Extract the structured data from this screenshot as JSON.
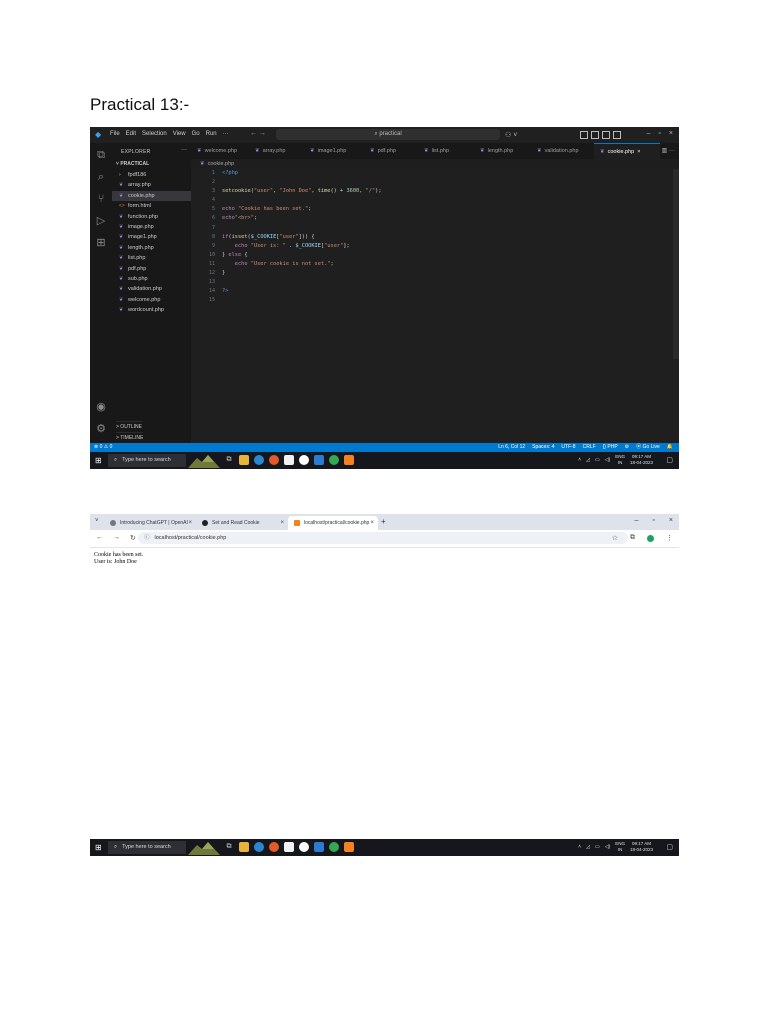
{
  "document": {
    "title": "Practical 13:-"
  },
  "vscode": {
    "menu": [
      "File",
      "Edit",
      "Selection",
      "View",
      "Go",
      "Run",
      "···"
    ],
    "nav_arrows": "← →",
    "search_text": "⌕ practical",
    "explorer_header": "EXPLORER",
    "explorer_dots": "···",
    "project": "PRACTICAL",
    "files": [
      {
        "name": "fpdf186",
        "kind": "folder"
      },
      {
        "name": "array.php",
        "kind": "php"
      },
      {
        "name": "cookie.php",
        "kind": "php"
      },
      {
        "name": "form.html",
        "kind": "html"
      },
      {
        "name": "function.php",
        "kind": "php"
      },
      {
        "name": "image.php",
        "kind": "php"
      },
      {
        "name": "image1.php",
        "kind": "php"
      },
      {
        "name": "length.php",
        "kind": "php"
      },
      {
        "name": "list.php",
        "kind": "php"
      },
      {
        "name": "pdf.php",
        "kind": "php"
      },
      {
        "name": "sub.php",
        "kind": "php"
      },
      {
        "name": "validation.php",
        "kind": "php"
      },
      {
        "name": "welcome.php",
        "kind": "php"
      },
      {
        "name": "wordcount.php",
        "kind": "php"
      }
    ],
    "outline_label": "> OUTLINE",
    "timeline_label": "> TIMELINE",
    "tabs": [
      "welcome.php",
      "array.php",
      "image1.php",
      "pdf.php",
      "list.php",
      "length.php",
      "validation.php",
      "cookie.php"
    ],
    "active_tab_close": "×",
    "breadcrumb": "cookie.php",
    "line_numbers": [
      "1",
      "2",
      "3",
      "4",
      "5",
      "6",
      "7",
      "8",
      "9",
      "10",
      "11",
      "12",
      "13",
      "14",
      "15"
    ],
    "code_lines": [
      "<?php",
      "",
      "setcookie(\"user\", \"John Doe\", time() + 3600, \"/\");",
      "",
      "echo \"Cookie has been set.\";",
      "echo\"<br>\";",
      "",
      "if(isset($_COOKIE[\"user\"])) {",
      "    echo \"User is: \" . $_COOKIE[\"user\"];",
      "} else {",
      "    echo \"User cookie is not set.\";",
      "}",
      "",
      "?>",
      ""
    ],
    "status_left": "⊗ 0 ⚠ 0",
    "status_right": [
      "Ln 6, Col 12",
      "Spaces: 4",
      "UTF-8",
      "CRLF",
      "{} PHP",
      "⚙",
      "⦿ Go Live",
      "🔔"
    ]
  },
  "taskbar": {
    "search_placeholder": "Type here to search",
    "lang": "ENG",
    "region": "IN",
    "time": "09:17 AM",
    "date": "18-04-2023"
  },
  "browser": {
    "tabs": [
      {
        "title": "Introducing ChatGPT | OpenAI"
      },
      {
        "title": "Set and Read Cookie"
      },
      {
        "title": "localhost/practical/cookie.php"
      }
    ],
    "url": "localhost/practical/cookie.php",
    "output_lines": [
      "Cookie has been set.",
      "User is: John Doe"
    ]
  }
}
